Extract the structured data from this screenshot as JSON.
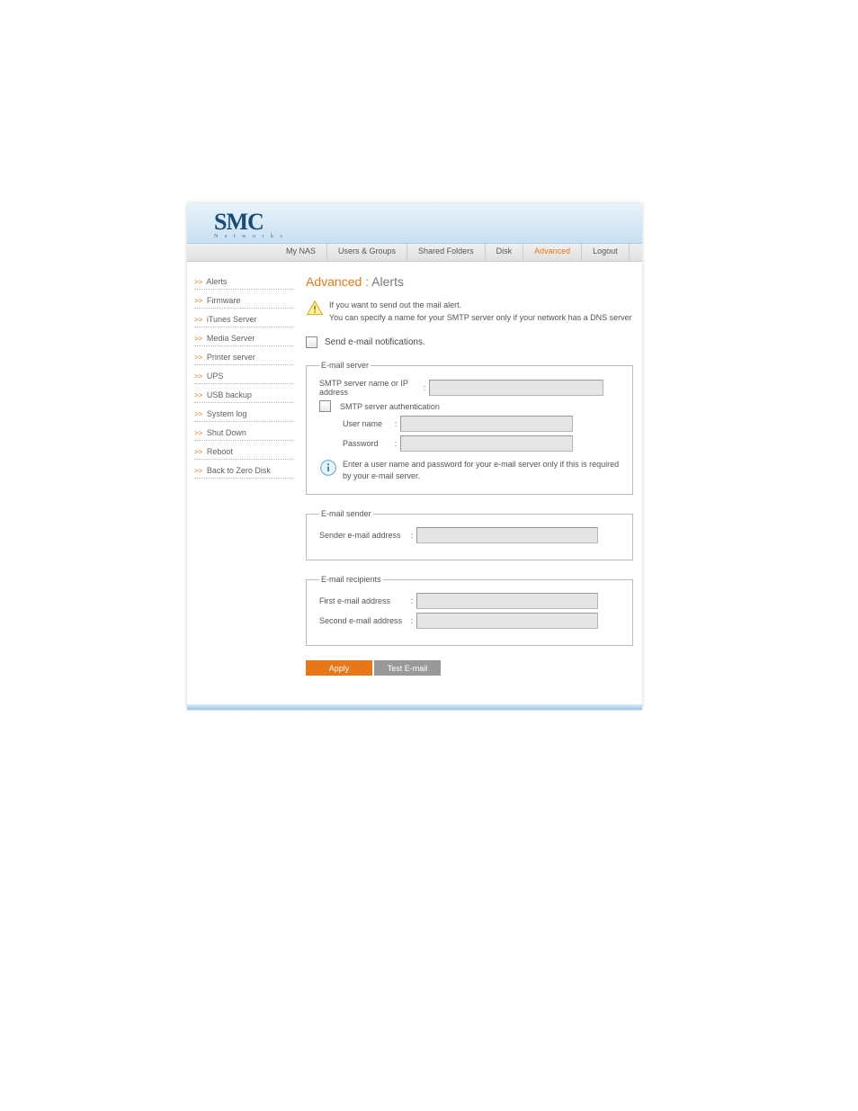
{
  "logo": {
    "main": "SMC",
    "sub": "N e t w o r k s"
  },
  "nav": [
    "My NAS",
    "Users & Groups",
    "Shared Folders",
    "Disk",
    "Advanced",
    "Logout"
  ],
  "nav_active": 4,
  "sidebar": [
    "Alerts",
    "Firmware",
    "iTunes Server",
    "Media Server",
    "Printer server",
    "UPS",
    "USB backup",
    "System log",
    "Shut Down",
    "Reboot",
    "Back to Zero Disk"
  ],
  "title": {
    "prefix": "Advanced :",
    "name": " Alerts"
  },
  "alert": {
    "line1": "If you want to send out the mail alert.",
    "line2": "You can specify a name for your SMTP server only if your network has a DNS server"
  },
  "send_label": "Send e-mail notifications.",
  "fs1": {
    "legend": "E-mail server",
    "smtp_label": "SMTP server name or IP address",
    "auth_label": "SMTP server authentication",
    "user_label": "User name",
    "pass_label": "Password",
    "info": "Enter a user name and password for your e-mail server only if this is required by your e-mail server."
  },
  "fs2": {
    "legend": "E-mail sender",
    "sender_label": "Sender e-mail address"
  },
  "fs3": {
    "legend": "E-mail recipients",
    "first_label": "First e-mail address",
    "second_label": "Second e-mail address"
  },
  "btn": {
    "apply": "Apply",
    "test": "Test E-mail"
  }
}
